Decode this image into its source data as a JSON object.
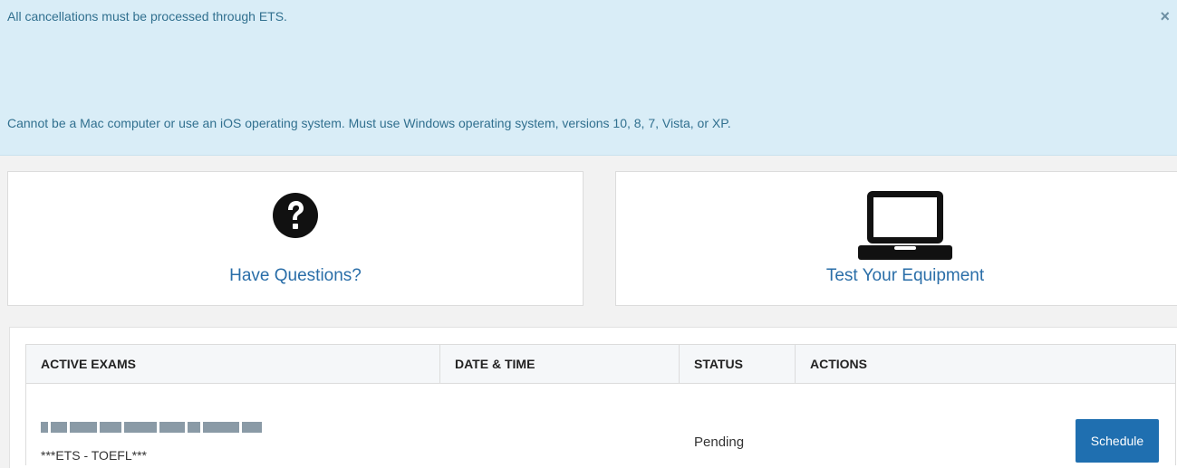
{
  "alert": {
    "line1": "All cancellations must be processed through ETS.",
    "line2": "Cannot be a Mac computer or use an iOS operating system. Must use Windows operating system, versions 10, 8, 7, Vista, or XP.",
    "close_label": "×"
  },
  "cards": [
    {
      "label": "Have Questions?",
      "icon": "question-circle-icon"
    },
    {
      "label": "Test Your Equipment",
      "icon": "laptop-icon"
    }
  ],
  "table": {
    "headers": [
      "ACTIVE EXAMS",
      "DATE & TIME",
      "STATUS",
      "ACTIONS"
    ],
    "rows": [
      {
        "exam_subtitle": "***ETS - TOEFL***",
        "date_time": "",
        "status": "Pending",
        "action_label": "Schedule"
      }
    ]
  },
  "colors": {
    "alert_bg": "#d9edf7",
    "link": "#2a6ea8",
    "button": "#1f6fb0"
  }
}
